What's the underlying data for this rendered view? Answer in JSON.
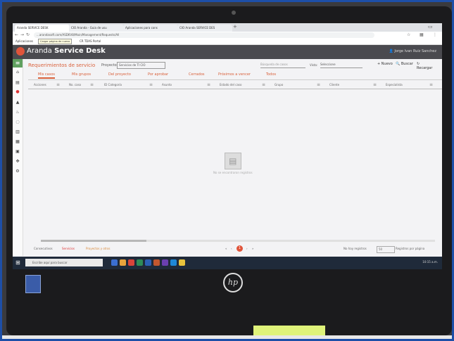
{
  "browser": {
    "tabs": [
      "Aranda SERVICE DESK",
      "CIO Aranda - Guia de usu",
      "Aplicaciones para cons",
      "CIO Aranda SERVICE DES"
    ],
    "url": "...arandasoft.com/ASDKV8/Main/Management/Requests/All",
    "tooltip": "Cargar página de nuevo",
    "bookmarks": [
      "Aplicaciones",
      "CIO Aranda",
      "CR TDAS Portal"
    ]
  },
  "app": {
    "brand_plain": "Aranda ",
    "brand_bold": "Service Desk",
    "user": "Jorge Ivan Ruiz Sanchez",
    "brand_color": "#e0543a",
    "header_color": "#4a4a4f"
  },
  "sidebar": {
    "items": [
      "home-icon",
      "case-icon",
      "alert-icon",
      "hazard-icon",
      "flame-icon",
      "chat-icon",
      "chart-icon",
      "report-icon",
      "calendar-icon",
      "tools-icon",
      "settings-icon"
    ]
  },
  "page": {
    "title": "Requerimientos de servicio",
    "project_label": "Proyecto:",
    "project_value": "Servicios de TI CIO",
    "search_placeholder": "Búsqueda de casos",
    "view_label": "Vista:",
    "view_value": "Seleccione",
    "new_label": "Nuevo",
    "search_label": "Buscar",
    "refresh_label": "Recargar"
  },
  "tabs": [
    "Mis casos",
    "Mis grupos",
    "Del proyecto",
    "Por aprobar",
    "Cerrados",
    "Próximos a vencer",
    "Todos"
  ],
  "columns": [
    "Acciones",
    "No. caso",
    "ID Categoría",
    "Asunto",
    "Estado del caso",
    "Grupo",
    "Cliente",
    "Especialista"
  ],
  "empty_state": "No se encontraron registros",
  "footer": {
    "legend": [
      "Consecutivos",
      "Servicios",
      "Proyectos y otros"
    ],
    "page_number": "1",
    "total_label": "No hay registros",
    "page_size": "50",
    "page_size_label": "Registros por página"
  },
  "taskbar": {
    "search_placeholder": "Escribe aquí para buscar",
    "clock": "10:15 a.m."
  },
  "device": {
    "brand": "hp"
  }
}
